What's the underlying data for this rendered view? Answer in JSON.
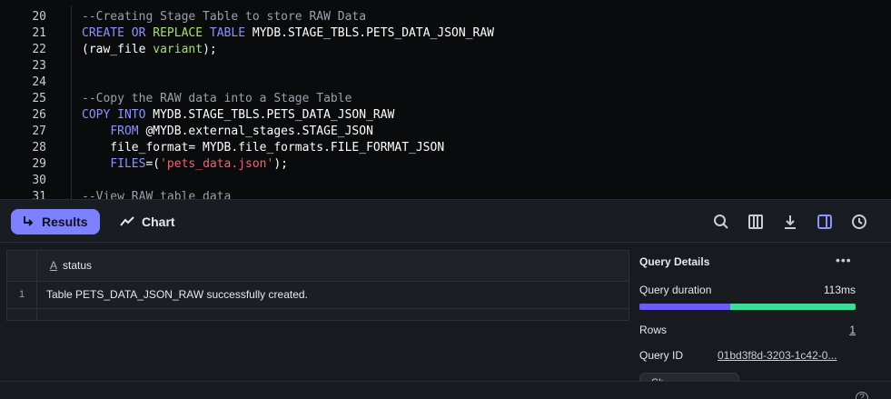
{
  "editor": {
    "lines": [
      {
        "num": "20",
        "tokens": [
          {
            "t": "--Creating Stage Table to store RAW Data",
            "c": "cm"
          }
        ]
      },
      {
        "num": "21",
        "tokens": [
          {
            "t": "CREATE",
            "c": "kw"
          },
          {
            "t": " ",
            "c": "plain"
          },
          {
            "t": "OR",
            "c": "kw"
          },
          {
            "t": " ",
            "c": "plain"
          },
          {
            "t": "REPLACE",
            "c": "kw2"
          },
          {
            "t": " ",
            "c": "plain"
          },
          {
            "t": "TABLE",
            "c": "kw"
          },
          {
            "t": " MYDB.STAGE_TBLS.PETS_DATA_JSON_RAW",
            "c": "plain"
          }
        ]
      },
      {
        "num": "22",
        "tokens": [
          {
            "t": "(raw_file ",
            "c": "plain"
          },
          {
            "t": "variant",
            "c": "kw2"
          },
          {
            "t": ");",
            "c": "plain"
          }
        ]
      },
      {
        "num": "23",
        "tokens": []
      },
      {
        "num": "24",
        "tokens": []
      },
      {
        "num": "25",
        "tokens": [
          {
            "t": "--Copy the RAW data into a Stage Table",
            "c": "cm"
          }
        ]
      },
      {
        "num": "26",
        "tokens": [
          {
            "t": "COPY",
            "c": "kw"
          },
          {
            "t": " ",
            "c": "plain"
          },
          {
            "t": "INTO",
            "c": "kw"
          },
          {
            "t": " MYDB.STAGE_TBLS.PETS_DATA_JSON_RAW",
            "c": "plain"
          }
        ]
      },
      {
        "num": "27",
        "tokens": [
          {
            "t": "    ",
            "c": "plain"
          },
          {
            "t": "FROM",
            "c": "kw"
          },
          {
            "t": " @MYDB.external_stages.STAGE_JSON",
            "c": "plain"
          }
        ]
      },
      {
        "num": "28",
        "tokens": [
          {
            "t": "    file_format= MYDB.file_formats.FILE_FORMAT_JSON",
            "c": "plain"
          }
        ]
      },
      {
        "num": "29",
        "tokens": [
          {
            "t": "    ",
            "c": "plain"
          },
          {
            "t": "FILES",
            "c": "kw"
          },
          {
            "t": "=(",
            "c": "plain"
          },
          {
            "t": "'pets_data.json'",
            "c": "str"
          },
          {
            "t": ");",
            "c": "plain"
          }
        ]
      },
      {
        "num": "30",
        "tokens": []
      },
      {
        "num": "31",
        "tokens": [
          {
            "t": "--View RAW table data",
            "c": "cm"
          }
        ]
      }
    ]
  },
  "toolbar": {
    "results_label": "Results",
    "chart_label": "Chart",
    "tools": [
      "search-icon",
      "columns-icon",
      "download-icon",
      "sidebar-toggle-icon",
      "history-icon"
    ]
  },
  "results": {
    "column": {
      "type_icon": "A",
      "name": "status"
    },
    "rows": [
      {
        "num": "1",
        "status": "Table PETS_DATA_JSON_RAW successfully created."
      }
    ]
  },
  "details": {
    "title": "Query Details",
    "more": "•••",
    "duration_label": "Query duration",
    "duration_value": "113ms",
    "duration_split": 0.42,
    "rows_label": "Rows",
    "rows_value": "1",
    "query_id_label": "Query ID",
    "query_id_value": "01bd3f8d-3203-1c42-0...",
    "stub_button": "Sh..."
  },
  "colors": {
    "accent": "#7c82ff",
    "bar_purple": "#6b5cf6",
    "bar_green": "#3ddc97"
  },
  "footer": {
    "help": "?"
  }
}
